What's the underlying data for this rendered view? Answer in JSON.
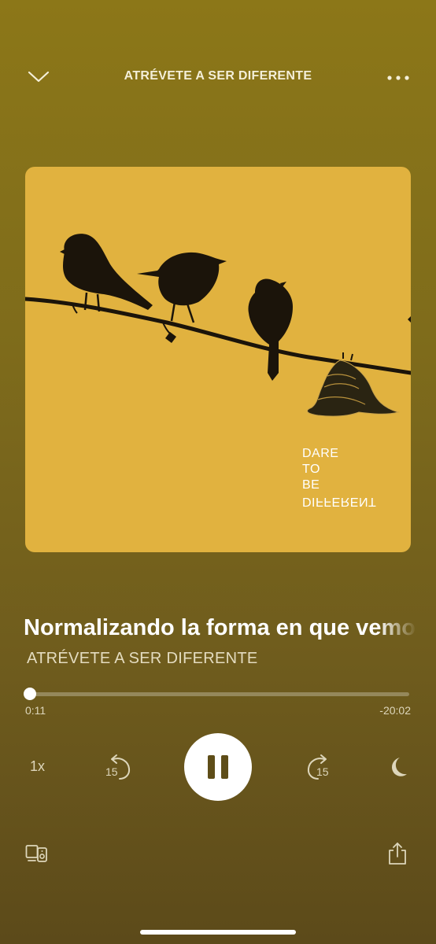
{
  "header": {
    "title": "ATRÉVETE A SER DIFERENTE",
    "collapse_icon": "chevron-down-icon",
    "more_icon": "more-horizontal-icon"
  },
  "artwork": {
    "lines": [
      "DARE",
      "TO",
      "BE",
      "DIFFERENT"
    ],
    "background": "#e1b23f"
  },
  "episode": {
    "title": "Normalizando la forma en que vemos",
    "podcast": "ATRÉVETE A SER DIFERENTE"
  },
  "progress": {
    "elapsed": "0:11",
    "remaining": "-20:02",
    "fraction": 0.009
  },
  "controls": {
    "speed": "1x",
    "rewind_seconds": "15",
    "forward_seconds": "15",
    "rewind_icon": "rewind-15-icon",
    "forward_icon": "forward-15-icon",
    "play_state_icon": "pause-icon",
    "sleep_icon": "moon-icon",
    "devices_icon": "devices-icon",
    "share_icon": "share-icon"
  },
  "colors": {
    "background_top": "#8c7718",
    "background_bottom": "#5c4a1a",
    "accent": "#ffffff"
  }
}
